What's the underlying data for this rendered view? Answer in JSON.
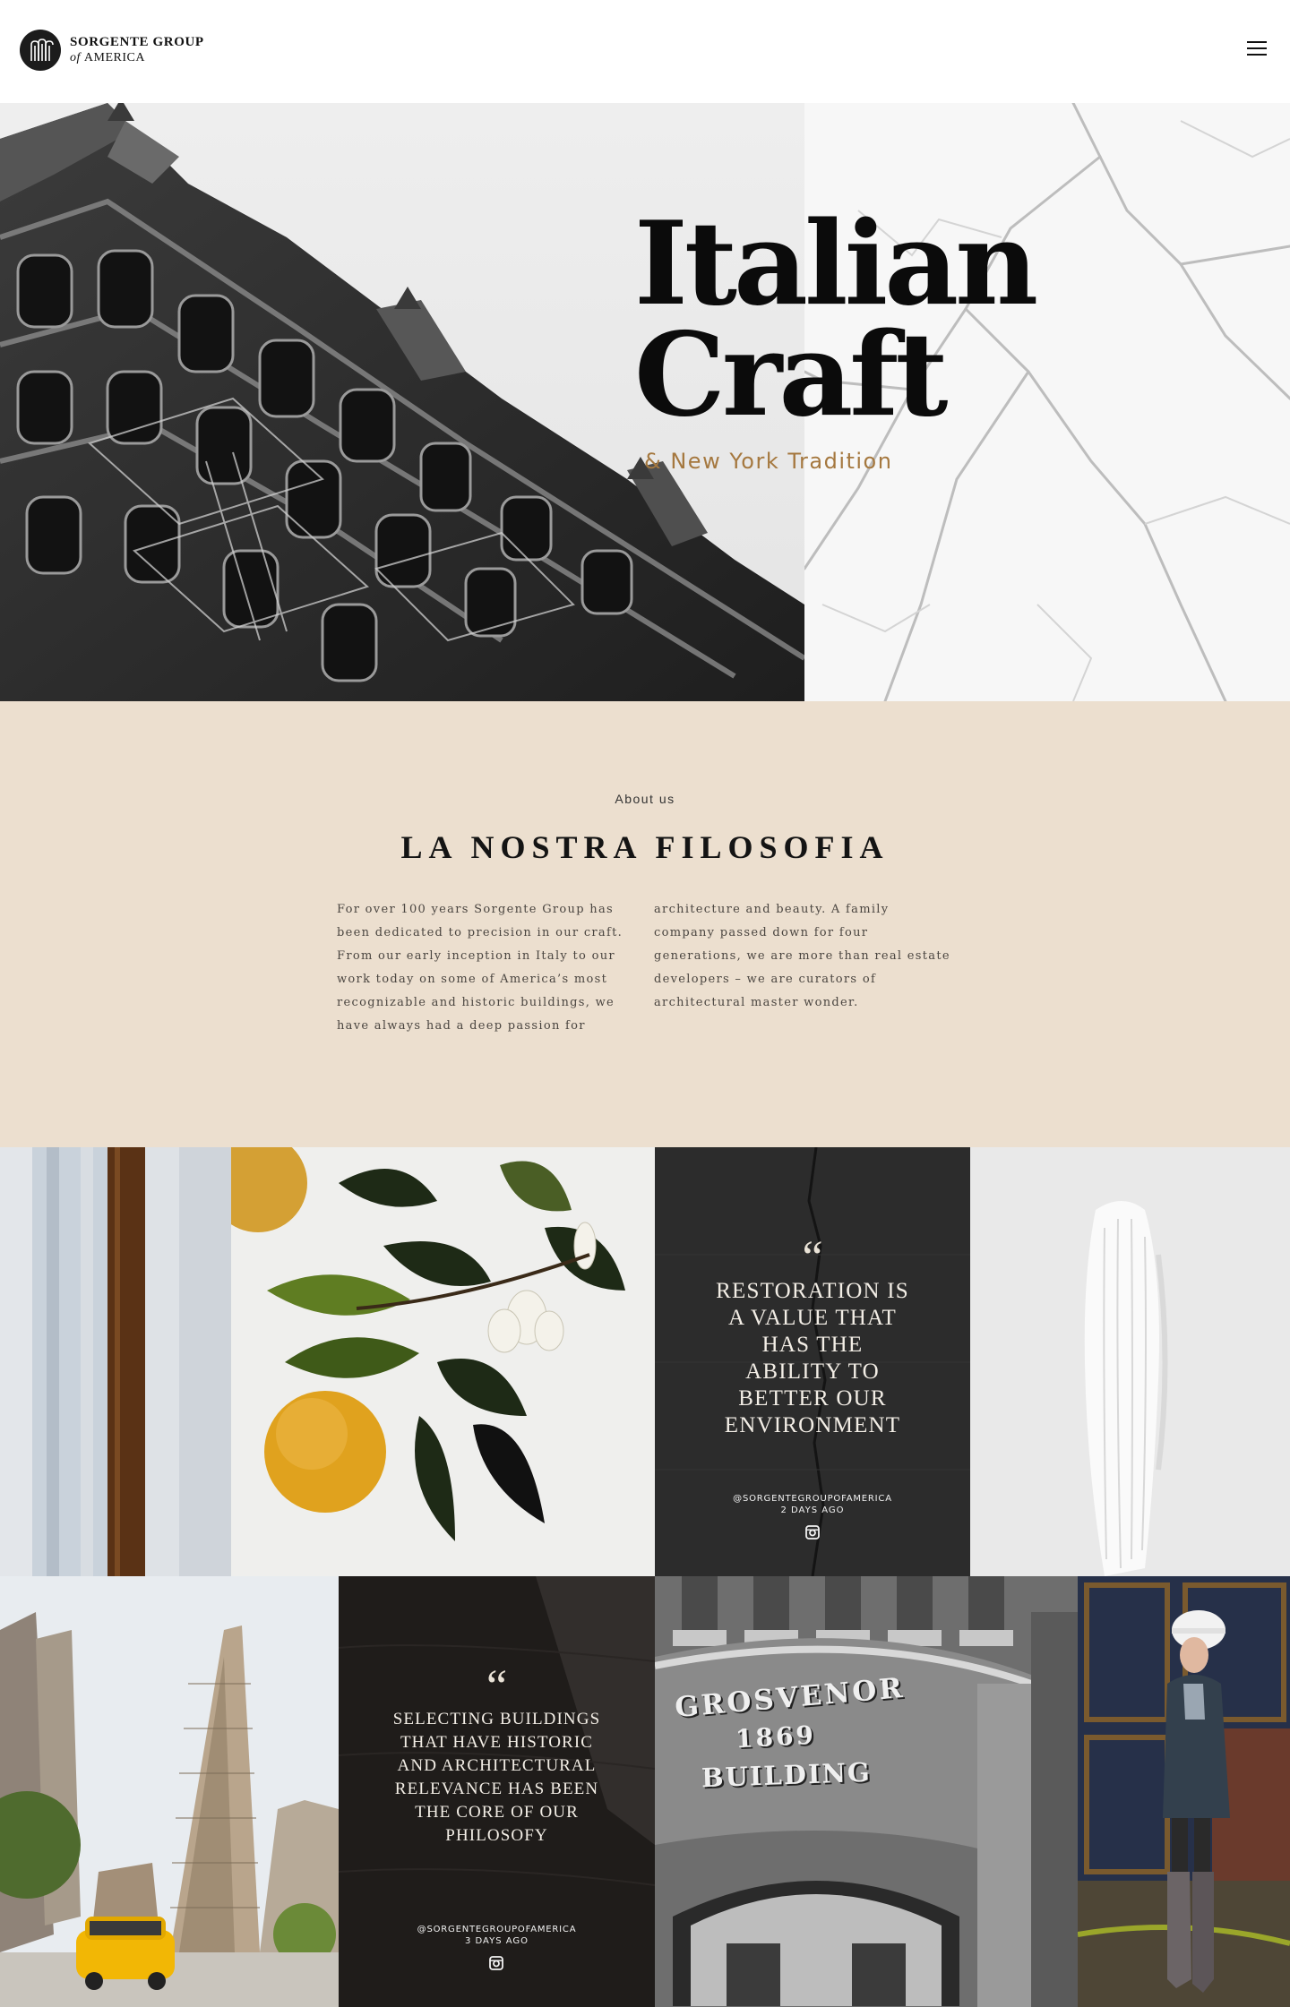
{
  "brand": {
    "line1": "SORGENTE GROUP",
    "line2_of": "of",
    "line2_name": "AMERICA",
    "logo_icon": "building-columns-icon"
  },
  "header": {
    "menu_icon": "hamburger-menu-icon"
  },
  "hero": {
    "title": "Italian\nCraft",
    "subtitle": "& New York Tradition",
    "accent_color": "#a5783f"
  },
  "about": {
    "eyebrow": "About us",
    "title": "LA NOSTRA FILOSOFIA",
    "column1": "For over 100 years Sorgente Group has been dedicated to precision in our craft. From our early inception in Italy to our work today on some of America’s most recognizable and historic buildings, we have always had a deep passion for",
    "column2": "architecture and beauty. A family company passed down for four generations, we are more than real estate developers – we are curators of architectural master wonder.",
    "background_color": "#ecdfcf"
  },
  "gallery": {
    "quote1": {
      "mark": "“",
      "text": "RESTORATION IS A VALUE THAT HAS THE ABILITY TO BETTER OUR ENVIRONMENT",
      "handle": "@SORGENTEGROUPOFAMERICA",
      "time": "2 DAYS AGO",
      "icon": "instagram-icon"
    },
    "quote2": {
      "mark": "“",
      "text": "SELECTING BUILDINGS THAT HAVE HISTORIC AND ARCHITECTURAL RELEVANCE HAS BEEN THE CORE OF OUR PHILOSOFY",
      "handle": "@SORGENTEGROUPOFAMERICA",
      "time": "3 DAYS AGO",
      "icon": "instagram-icon"
    },
    "building_sign": {
      "line1": "GROSVENOR",
      "line2": "1869",
      "line3": "BUILDING"
    }
  }
}
